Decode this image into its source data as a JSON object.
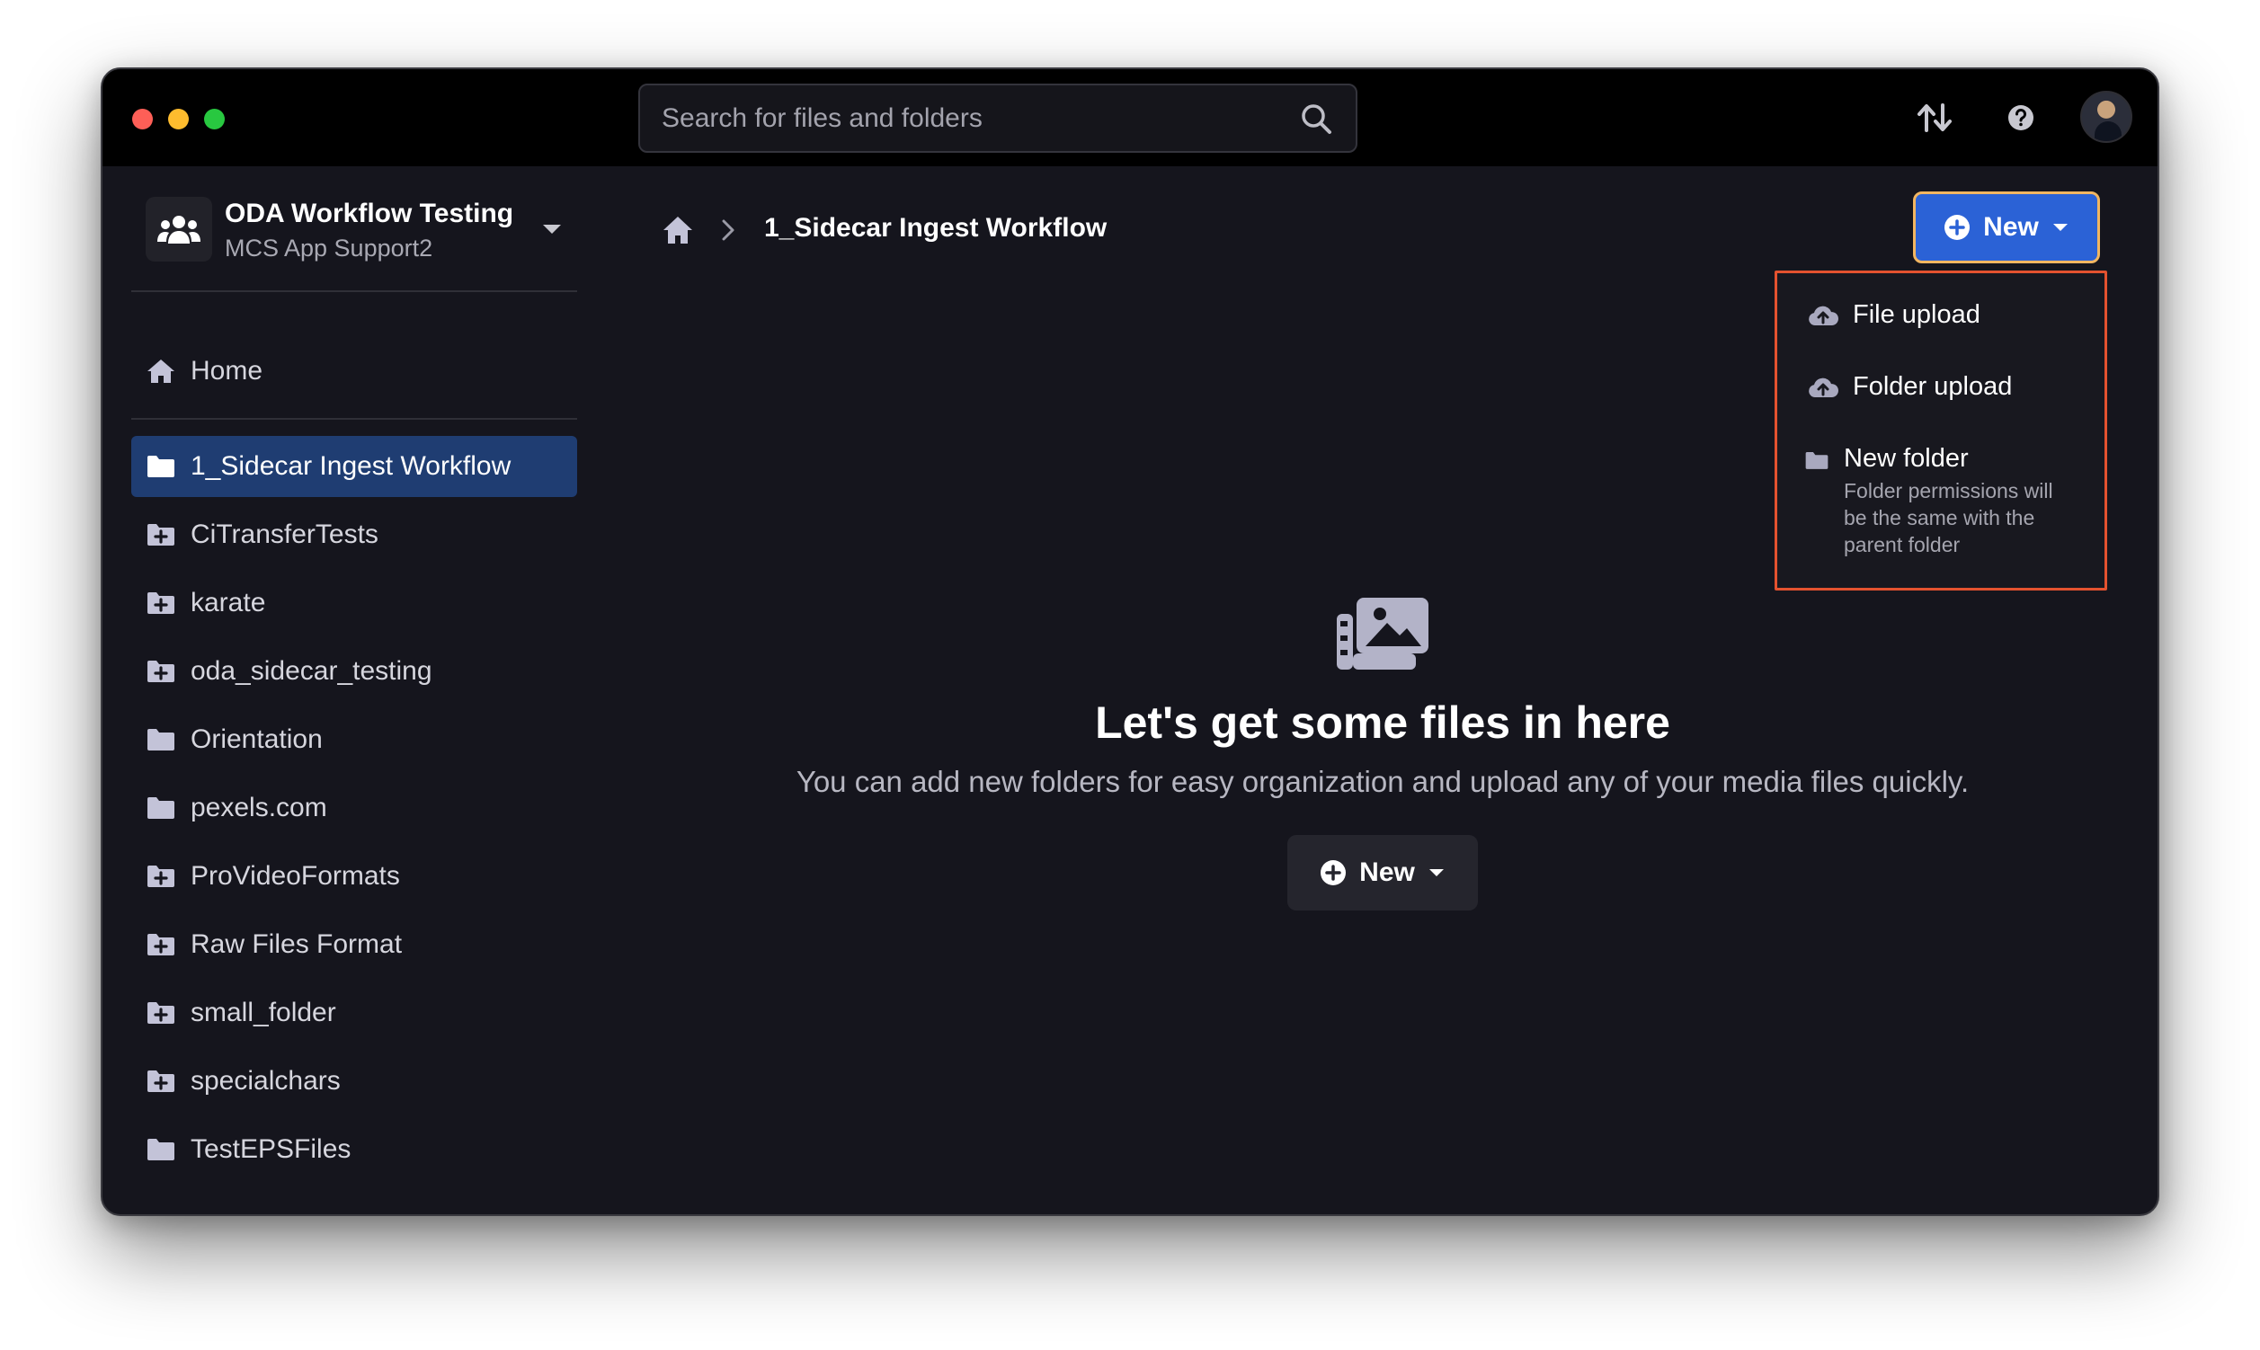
{
  "search": {
    "placeholder": "Search for files and folders"
  },
  "workspace": {
    "name": "ODA Workflow Testing",
    "subtitle": "MCS App Support2"
  },
  "sidebar": {
    "home_label": "Home",
    "items": [
      {
        "label": "1_Sidecar Ingest Workflow",
        "icon": "folder-icon",
        "active": true
      },
      {
        "label": "CiTransferTests",
        "icon": "folder-plus-icon"
      },
      {
        "label": "karate",
        "icon": "folder-plus-icon"
      },
      {
        "label": "oda_sidecar_testing",
        "icon": "folder-plus-icon"
      },
      {
        "label": "Orientation",
        "icon": "folder-icon"
      },
      {
        "label": "pexels.com",
        "icon": "folder-icon"
      },
      {
        "label": "ProVideoFormats",
        "icon": "folder-plus-icon"
      },
      {
        "label": "Raw Files Format",
        "icon": "folder-plus-icon"
      },
      {
        "label": "small_folder",
        "icon": "folder-plus-icon"
      },
      {
        "label": "specialchars",
        "icon": "folder-plus-icon"
      },
      {
        "label": "TestEPSFiles",
        "icon": "folder-icon"
      }
    ]
  },
  "breadcrumb": {
    "current": "1_Sidecar Ingest Workflow"
  },
  "toolbar": {
    "new_label": "New"
  },
  "new_menu": {
    "file_upload": "File upload",
    "folder_upload": "Folder upload",
    "new_folder": "New folder",
    "new_folder_desc": "Folder permissions will be the same with the parent folder"
  },
  "empty_state": {
    "title": "Let's get some files in here",
    "subtitle": "You can add new folders for easy organization and upload any of your media files quickly.",
    "new_label": "New"
  },
  "colors": {
    "accent": "#2b62d6",
    "active_item": "#1f3d72",
    "highlight": "#e4522f"
  }
}
